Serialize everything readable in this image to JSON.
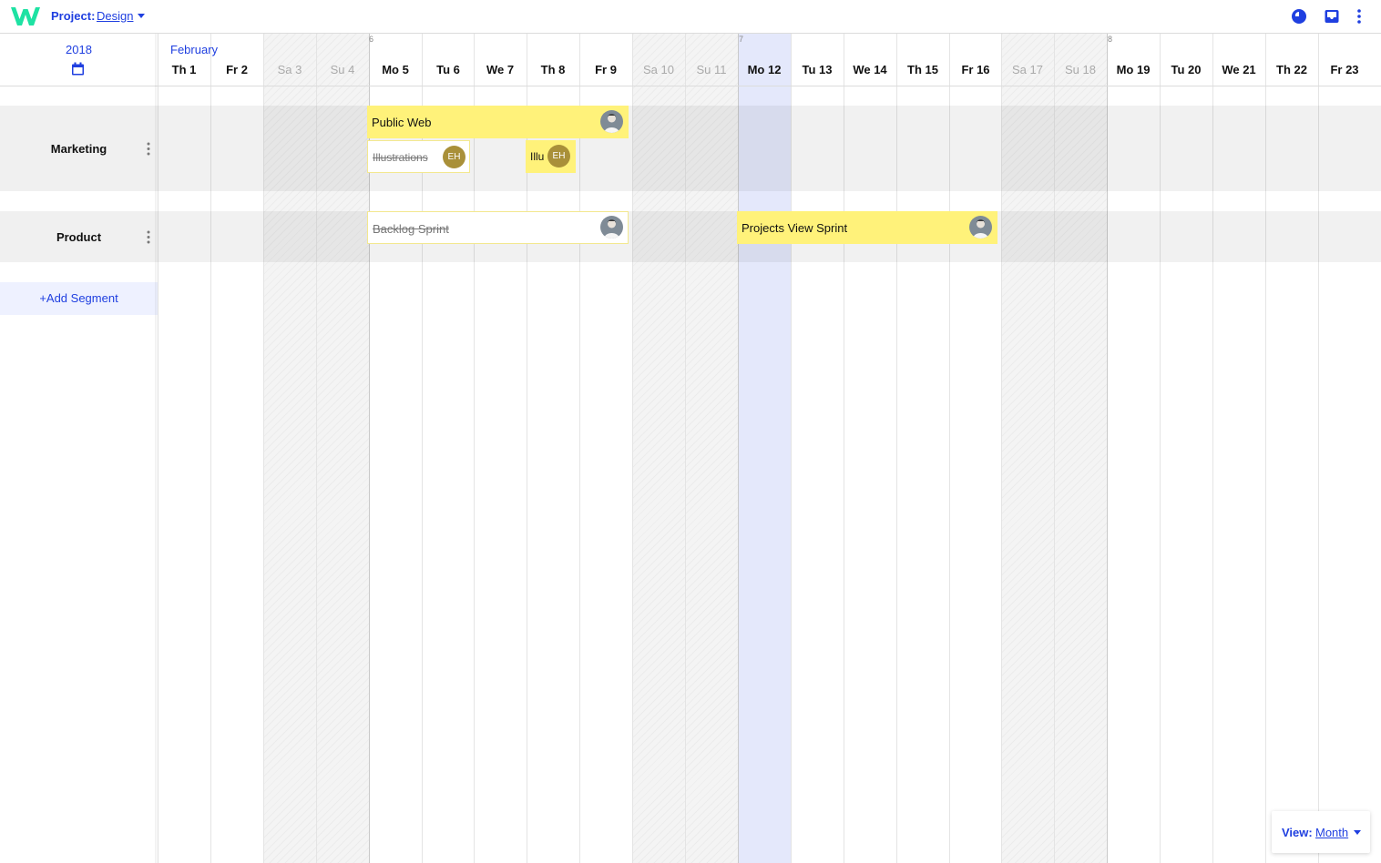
{
  "app": {
    "project_label": "Project:",
    "project_name": "Design",
    "icons": [
      "logo-w-icon",
      "clock-icon",
      "inbox-icon",
      "more-vert-icon"
    ],
    "accent_color": "#1f3fe0",
    "brand_color": "#1ee2a3"
  },
  "left_panel": {
    "year": "2018",
    "segments": [
      {
        "name": "Marketing"
      },
      {
        "name": "Product"
      }
    ],
    "add_segment_label": "+Add Segment"
  },
  "timeline": {
    "month": "February",
    "week_numbers": [
      "6",
      "7",
      "8"
    ],
    "today": "Mo 12",
    "days": [
      {
        "label": "Th 1",
        "weekend": false
      },
      {
        "label": "Fr 2",
        "weekend": false
      },
      {
        "label": "Sa 3",
        "weekend": true
      },
      {
        "label": "Su 4",
        "weekend": true
      },
      {
        "label": "Mo 5",
        "weekend": false
      },
      {
        "label": "Tu 6",
        "weekend": false
      },
      {
        "label": "We 7",
        "weekend": false
      },
      {
        "label": "Th 8",
        "weekend": false
      },
      {
        "label": "Fr 9",
        "weekend": false
      },
      {
        "label": "Sa 10",
        "weekend": true
      },
      {
        "label": "Su 11",
        "weekend": true
      },
      {
        "label": "Mo 12",
        "weekend": false
      },
      {
        "label": "Tu 13",
        "weekend": false
      },
      {
        "label": "We 14",
        "weekend": false
      },
      {
        "label": "Th 15",
        "weekend": false
      },
      {
        "label": "Fr 16",
        "weekend": false
      },
      {
        "label": "Sa 17",
        "weekend": true
      },
      {
        "label": "Su 18",
        "weekend": true
      },
      {
        "label": "Mo 19",
        "weekend": false
      },
      {
        "label": "Tu 20",
        "weekend": false
      },
      {
        "label": "We 21",
        "weekend": false
      },
      {
        "label": "Th 22",
        "weekend": false
      },
      {
        "label": "Fr 23",
        "weekend": false
      }
    ],
    "event_color": "#fff27a"
  },
  "events": {
    "public_web": {
      "title": "Public Web",
      "segment": "Marketing",
      "start": "Mo 5",
      "end": "Fr 9",
      "done": false
    },
    "illustrations_done": {
      "title": "Illustrations",
      "segment": "Marketing",
      "start": "Mo 5",
      "end": "Tu 6",
      "assignee": "EH",
      "done": true
    },
    "illustrations_open": {
      "title": "Illu",
      "segment": "Marketing",
      "start": "Th 8",
      "end": "Th 8",
      "assignee": "EH",
      "done": false
    },
    "backlog_sprint": {
      "title": "Backlog Sprint",
      "segment": "Product",
      "start": "Mo 5",
      "end": "Fr 9",
      "done": true
    },
    "projects_view_sprint": {
      "title": "Projects View Sprint",
      "segment": "Product",
      "start": "Mo 12",
      "end": "Fr 16",
      "done": false
    }
  },
  "view_selector": {
    "label": "View:",
    "value": "Month"
  }
}
